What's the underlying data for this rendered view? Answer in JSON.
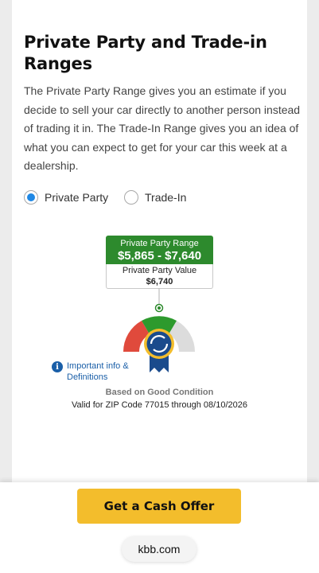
{
  "heading": "Private Party and Trade-in Ranges",
  "description": "The Private Party Range gives you an estimate if you decide to sell your car directly to another person instead of trading it in. The Trade-In Range gives you an idea of what you can expect to get for your car this week at a dealership.",
  "options": [
    {
      "label": "Private Party",
      "selected": true
    },
    {
      "label": "Trade-In",
      "selected": false
    }
  ],
  "range": {
    "title": "Private Party Range",
    "value": "$5,865 - $7,640"
  },
  "value_box": {
    "title": "Private Party Value",
    "value": "$6,740"
  },
  "info": {
    "icon": "info-icon",
    "text": "Important info & Definitions"
  },
  "condition": "Based on Good Condition",
  "valid_text": "Valid for ZIP Code 77015 through 08/10/2026",
  "cta_label": "Get a Cash Offer",
  "url": "kbb.com",
  "colors": {
    "accent_green": "#2d8a2d",
    "gauge_red": "#e04a3c",
    "gauge_gray": "#dcdcdc",
    "badge_blue": "#1a4b8c",
    "cta_yellow": "#f3bd2c",
    "radio_blue": "#1f88e5"
  }
}
